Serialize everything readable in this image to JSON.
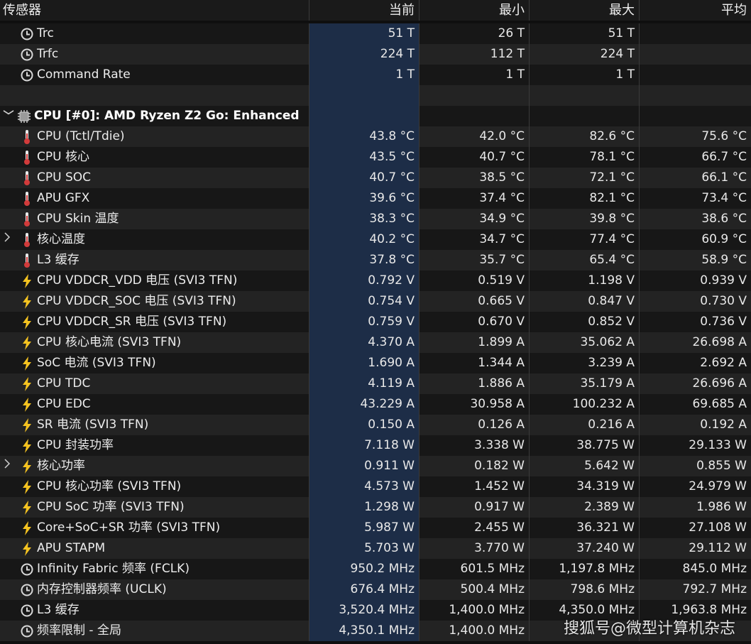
{
  "header": {
    "sensor": "传感器",
    "current": "当前",
    "min": "最小",
    "max": "最大",
    "avg": "平均"
  },
  "colors": {
    "current_col_bg": "#1d2d47",
    "thermo_red": "#d23b3b",
    "bolt_yellow": "#f5c320",
    "clock_gray": "#d8d8d8"
  },
  "rows": [
    {
      "type": "sensor",
      "icon": "clock-icon",
      "label": "Trc",
      "cur": "51 T",
      "min": "26 T",
      "max": "51 T",
      "avg": ""
    },
    {
      "type": "sensor",
      "icon": "clock-icon",
      "label": "Trfc",
      "cur": "224 T",
      "min": "112 T",
      "max": "224 T",
      "avg": ""
    },
    {
      "type": "sensor",
      "icon": "clock-icon",
      "label": "Command Rate",
      "cur": "1 T",
      "min": "1 T",
      "max": "1 T",
      "avg": ""
    },
    {
      "type": "blank",
      "label": "",
      "cur": "",
      "min": "",
      "max": "",
      "avg": ""
    },
    {
      "type": "group",
      "icon": "chip-icon",
      "label": "CPU [#0]: AMD Ryzen Z2 Go: Enhanced",
      "cur": "",
      "min": "",
      "max": "",
      "avg": ""
    },
    {
      "type": "sensor",
      "icon": "thermometer-icon",
      "label": "CPU (Tctl/Tdie)",
      "cur": "43.8 °C",
      "min": "42.0 °C",
      "max": "82.6 °C",
      "avg": "75.6 °C"
    },
    {
      "type": "sensor",
      "icon": "thermometer-icon",
      "label": "CPU 核心",
      "cur": "43.5 °C",
      "min": "40.7 °C",
      "max": "78.1 °C",
      "avg": "66.7 °C"
    },
    {
      "type": "sensor",
      "icon": "thermometer-icon",
      "label": "CPU SOC",
      "cur": "40.7 °C",
      "min": "38.5 °C",
      "max": "72.1 °C",
      "avg": "66.1 °C"
    },
    {
      "type": "sensor",
      "icon": "thermometer-icon",
      "label": "APU GFX",
      "cur": "39.6 °C",
      "min": "37.4 °C",
      "max": "82.1 °C",
      "avg": "73.4 °C"
    },
    {
      "type": "sensor",
      "icon": "thermometer-icon",
      "label": "CPU Skin 温度",
      "cur": "38.3 °C",
      "min": "34.9 °C",
      "max": "39.8 °C",
      "avg": "38.6 °C"
    },
    {
      "type": "expandable",
      "icon": "thermometer-icon",
      "label": "核心温度",
      "cur": "40.2 °C",
      "min": "34.7 °C",
      "max": "77.4 °C",
      "avg": "60.9 °C"
    },
    {
      "type": "sensor",
      "icon": "thermometer-icon",
      "label": "L3 缓存",
      "cur": "37.8 °C",
      "min": "35.7 °C",
      "max": "65.4 °C",
      "avg": "58.9 °C"
    },
    {
      "type": "sensor",
      "icon": "bolt-icon",
      "label": "CPU VDDCR_VDD 电压 (SVI3 TFN)",
      "cur": "0.792 V",
      "min": "0.519 V",
      "max": "1.198 V",
      "avg": "0.939 V"
    },
    {
      "type": "sensor",
      "icon": "bolt-icon",
      "label": "CPU VDDCR_SOC 电压 (SVI3 TFN)",
      "cur": "0.754 V",
      "min": "0.665 V",
      "max": "0.847 V",
      "avg": "0.730 V"
    },
    {
      "type": "sensor",
      "icon": "bolt-icon",
      "label": "CPU VDDCR_SR 电压 (SVI3 TFN)",
      "cur": "0.759 V",
      "min": "0.670 V",
      "max": "0.852 V",
      "avg": "0.736 V"
    },
    {
      "type": "sensor",
      "icon": "bolt-icon",
      "label": "CPU 核心电流 (SVI3 TFN)",
      "cur": "4.370 A",
      "min": "1.899 A",
      "max": "35.062 A",
      "avg": "26.698 A"
    },
    {
      "type": "sensor",
      "icon": "bolt-icon",
      "label": "SoC 电流 (SVI3 TFN)",
      "cur": "1.690 A",
      "min": "1.344 A",
      "max": "3.239 A",
      "avg": "2.692 A"
    },
    {
      "type": "sensor",
      "icon": "bolt-icon",
      "label": "CPU TDC",
      "cur": "4.119 A",
      "min": "1.886 A",
      "max": "35.179 A",
      "avg": "26.696 A"
    },
    {
      "type": "sensor",
      "icon": "bolt-icon",
      "label": "CPU EDC",
      "cur": "43.229 A",
      "min": "30.958 A",
      "max": "100.232 A",
      "avg": "69.685 A"
    },
    {
      "type": "sensor",
      "icon": "bolt-icon",
      "label": "SR 电流 (SVI3 TFN)",
      "cur": "0.150 A",
      "min": "0.126 A",
      "max": "0.216 A",
      "avg": "0.192 A"
    },
    {
      "type": "sensor",
      "icon": "bolt-icon",
      "label": "CPU 封装功率",
      "cur": "7.118 W",
      "min": "3.338 W",
      "max": "38.775 W",
      "avg": "29.133 W"
    },
    {
      "type": "expandable",
      "icon": "bolt-icon",
      "label": "核心功率",
      "cur": "0.911 W",
      "min": "0.182 W",
      "max": "5.642 W",
      "avg": "0.855 W"
    },
    {
      "type": "sensor",
      "icon": "bolt-icon",
      "label": "CPU 核心功率 (SVI3 TFN)",
      "cur": "4.573 W",
      "min": "1.452 W",
      "max": "34.319 W",
      "avg": "24.979 W"
    },
    {
      "type": "sensor",
      "icon": "bolt-icon",
      "label": "CPU SoC 功率 (SVI3 TFN)",
      "cur": "1.298 W",
      "min": "0.917 W",
      "max": "2.389 W",
      "avg": "1.986 W"
    },
    {
      "type": "sensor",
      "icon": "bolt-icon",
      "label": "Core+SoC+SR 功率 (SVI3 TFN)",
      "cur": "5.987 W",
      "min": "2.455 W",
      "max": "36.321 W",
      "avg": "27.108 W"
    },
    {
      "type": "sensor",
      "icon": "bolt-icon",
      "label": "APU STAPM",
      "cur": "5.703 W",
      "min": "3.770 W",
      "max": "37.240 W",
      "avg": "29.112 W"
    },
    {
      "type": "sensor",
      "icon": "clock-icon",
      "label": "Infinity Fabric 频率 (FCLK)",
      "cur": "950.2 MHz",
      "min": "601.5 MHz",
      "max": "1,197.8 MHz",
      "avg": "845.0 MHz"
    },
    {
      "type": "sensor",
      "icon": "clock-icon",
      "label": "内存控制器频率 (UCLK)",
      "cur": "676.4 MHz",
      "min": "500.4 MHz",
      "max": "798.6 MHz",
      "avg": "792.7 MHz"
    },
    {
      "type": "sensor",
      "icon": "clock-icon",
      "label": "L3 缓存",
      "cur": "3,520.4 MHz",
      "min": "1,400.0 MHz",
      "max": "4,350.0 MHz",
      "avg": "1,963.8 MHz"
    },
    {
      "type": "sensor",
      "icon": "clock-icon",
      "label": "频率限制 - 全局",
      "cur": "4,350.1 MHz",
      "min": "1,400.0 MHz",
      "max": "",
      "avg": ""
    }
  ],
  "watermark": "搜狐号@微型计算机杂志"
}
